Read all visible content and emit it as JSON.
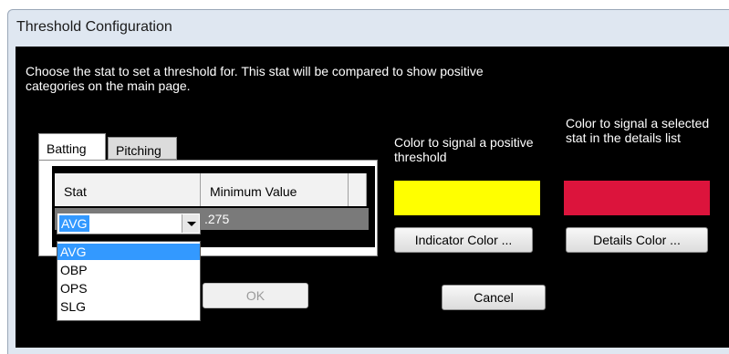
{
  "window": {
    "title": "Threshold Configuration"
  },
  "description": "Choose the stat to set a threshold for.  This stat will be compared to show positive categories on the main page.",
  "tabs": [
    {
      "label": "Batting",
      "active": true
    },
    {
      "label": "Pitching",
      "active": false
    }
  ],
  "grid": {
    "columns": [
      "Stat",
      "Minimum Value"
    ],
    "rows": [
      {
        "stat": "AVG",
        "min_value": ".275"
      }
    ]
  },
  "combo": {
    "selected": "AVG",
    "options": [
      "AVG",
      "OBP",
      "OPS",
      "SLG"
    ],
    "highlighted_option": "AVG"
  },
  "colors": {
    "positive_label": "Color to signal a positive threshold",
    "positive_color": "#ffff00",
    "selected_label": "Color to signal a selected stat in the details list",
    "selected_color": "#dc143c"
  },
  "buttons": {
    "indicator": "Indicator Color ...",
    "details": "Details Color ...",
    "ok": "OK",
    "cancel": "Cancel"
  }
}
